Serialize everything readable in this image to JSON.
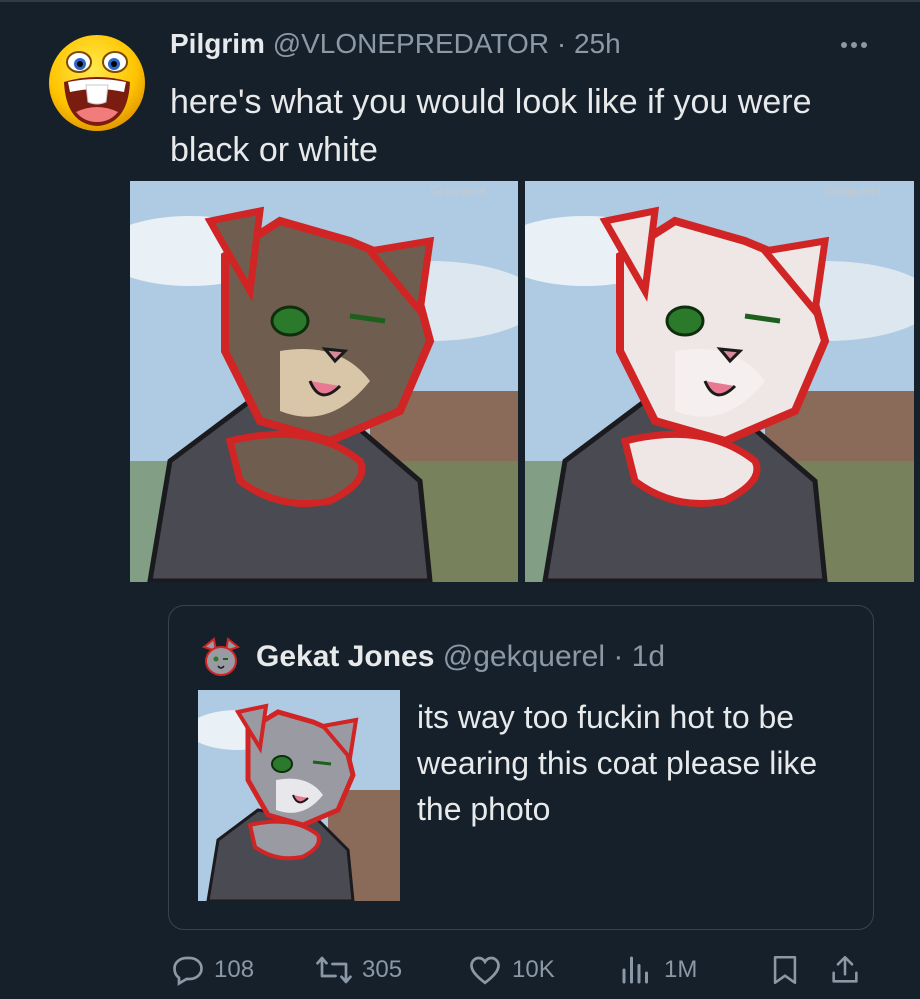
{
  "tweet": {
    "author_name": "Pilgrim",
    "handle": "@VLONEPREDATOR",
    "separator": "·",
    "time": "25h",
    "text": "here's what you would look like if you were black or white",
    "more_icon": "more-horizontal-icon",
    "media": [
      {
        "watermark": "Gekquerel",
        "fur": "#6f5e4f",
        "muzzle": "#d9c6a8",
        "subject": "brown-fur-cat-character"
      },
      {
        "watermark": "Gekquerel",
        "fur": "#efe6e6",
        "muzzle": "#f5efef",
        "subject": "white-fur-cat-character"
      }
    ]
  },
  "quote": {
    "author_name": "Gekat Jones",
    "handle": "@gekquerel",
    "separator": "·",
    "time": "1d",
    "text": "its way too fuckin hot to be wearing this coat please like the photo"
  },
  "actions": {
    "replies": {
      "icon": "reply-icon",
      "count": "108"
    },
    "reposts": {
      "icon": "repost-icon",
      "count": "305"
    },
    "likes": {
      "icon": "heart-icon",
      "count": "10K"
    },
    "views": {
      "icon": "views-icon",
      "count": "1M"
    },
    "bookmark": {
      "icon": "bookmark-icon"
    },
    "share": {
      "icon": "share-icon"
    }
  },
  "colors": {
    "background": "#15202b",
    "text": "#e7e9ea",
    "muted": "#8b98a5",
    "border": "#38444d"
  }
}
